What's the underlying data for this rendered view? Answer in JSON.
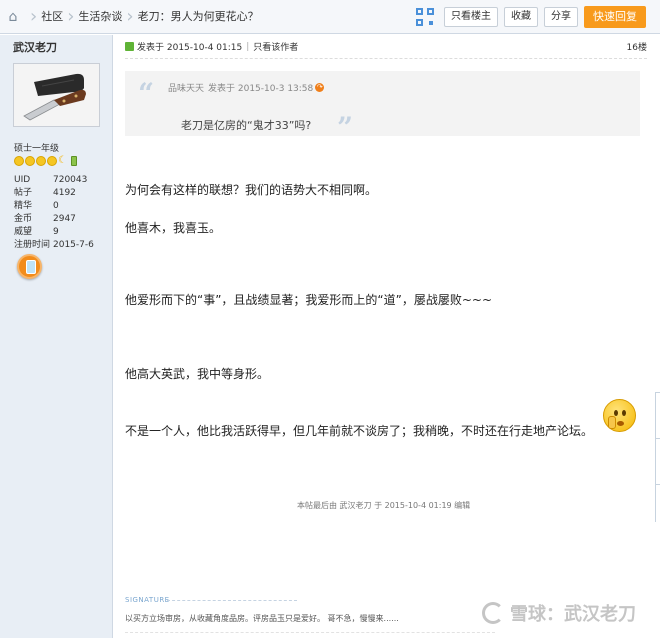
{
  "breadcrumb": {
    "items": [
      "社区",
      "生活杂谈",
      "老刀：男人为何更花心？"
    ]
  },
  "toolbar": {
    "only_owner": "只看楼主",
    "favorite": "收藏",
    "share": "分享",
    "quick_reply": "快速回复"
  },
  "user": {
    "name": "武汉老刀",
    "rank": "硕士一年级",
    "stats": [
      {
        "label": "UID",
        "value": "720043"
      },
      {
        "label": "帖子",
        "value": "4192"
      },
      {
        "label": "精华",
        "value": "0"
      },
      {
        "label": "金币",
        "value": "2947"
      },
      {
        "label": "威望",
        "value": "9"
      },
      {
        "label": "注册时间",
        "value": "2015-7-6"
      }
    ]
  },
  "post": {
    "time": "发表于 2015-10-4 01:15",
    "only_author": "只看该作者",
    "floor": "16楼",
    "quote": {
      "author": "品味天天",
      "time": "发表于 2015-10-3 13:58",
      "text": "老刀是亿房的“鬼才33”吗?"
    },
    "paragraphs": [
      "为何会有这样的联想？我们的语势大不相同啊。",
      "他喜木，我喜玉。",
      "他爱形而下的“事”，且战绩显著；我爱形而上的“道”，屡战屡败~~~",
      "他高大英武，我中等身形。",
      "不是一个人，他比我活跃得早，但几年前就不谈房了；我稍晚，不时还在行走地产论坛。"
    ],
    "edited": "本帖最后由 武汉老刀 于 2015-10-4 01:19 编辑",
    "signature_label": "SIGNATURE",
    "signature": "以买方立场审房，从收藏角度品房。评房品玉只是爱好。 哥不急，慢慢来......"
  },
  "watermark": "雪球：武汉老刀",
  "colors": {
    "accent": "#f89a1c",
    "sidebar_bg": "#e8eef5",
    "quote_bg": "#f3f3f3"
  }
}
